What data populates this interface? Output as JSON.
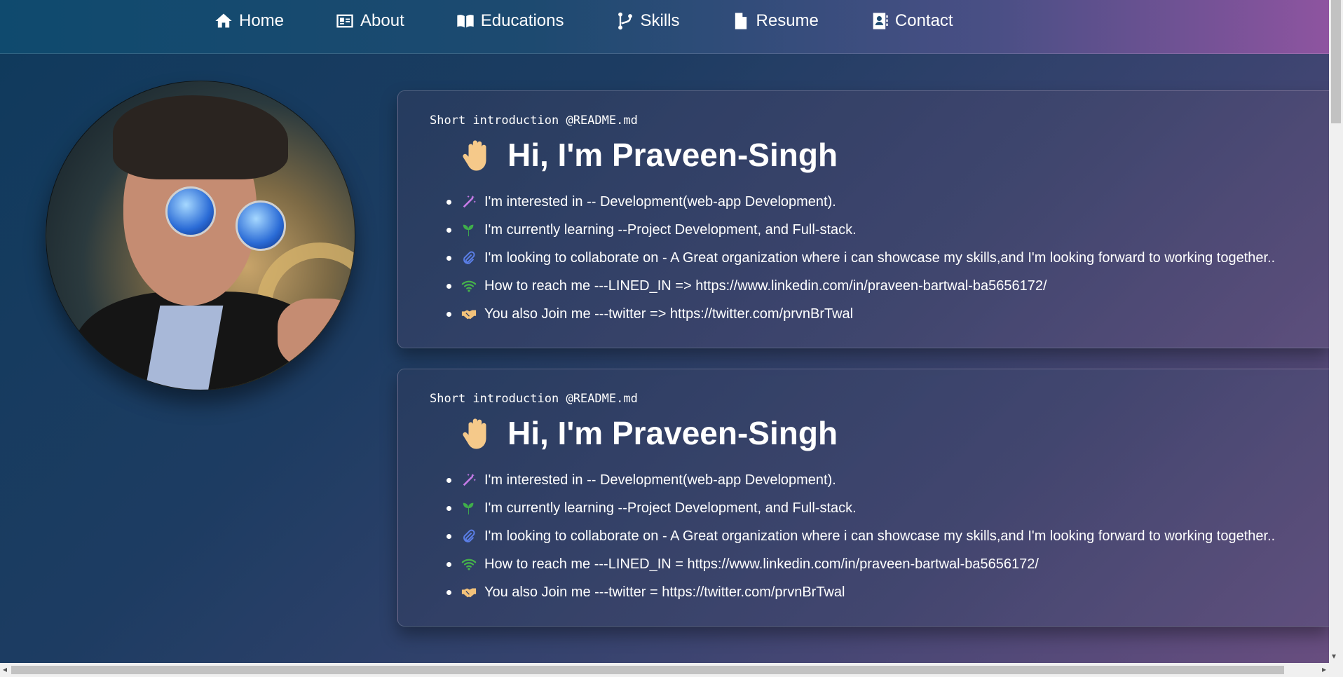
{
  "nav": {
    "items": [
      {
        "label": "Home",
        "icon": "home-icon"
      },
      {
        "label": "About",
        "icon": "id-card-icon"
      },
      {
        "label": "Educations",
        "icon": "book-icon"
      },
      {
        "label": "Skills",
        "icon": "code-branch-icon"
      },
      {
        "label": "Resume",
        "icon": "file-icon"
      },
      {
        "label": "Contact",
        "icon": "address-book-icon"
      }
    ]
  },
  "profile": {
    "image": "profile-photo"
  },
  "cards": [
    {
      "caption": "Short introduction @README.md",
      "heading": "Hi, I'm Praveen-Singh",
      "items": [
        {
          "icon": "magic-wand-icon",
          "text": "I'm interested in -- Development(web-app Development)."
        },
        {
          "icon": "seedling-icon",
          "text": "I'm currently learning --Project Development, and Full-stack."
        },
        {
          "icon": "paperclip-icon",
          "text": "I'm looking to collaborate on - A Great organization where i can showcase my skills,and I'm looking forward to working together.."
        },
        {
          "icon": "wifi-icon",
          "text": "How to reach me ---LINED_IN => https://www.linkedin.com/in/praveen-bartwal-ba5656172/"
        },
        {
          "icon": "handshake-icon",
          "text": "You also Join me ---twitter => https://twitter.com/prvnBrTwal"
        }
      ]
    },
    {
      "caption": "Short introduction @README.md",
      "heading": "Hi, I'm Praveen-Singh",
      "items": [
        {
          "icon": "magic-wand-icon",
          "text": "I'm interested in -- Development(web-app Development)."
        },
        {
          "icon": "seedling-icon",
          "text": "I'm currently learning --Project Development, and Full-stack."
        },
        {
          "icon": "paperclip-icon",
          "text": "I'm looking to collaborate on - A Great organization where i can showcase my skills,and I'm looking forward to working together.."
        },
        {
          "icon": "wifi-icon",
          "text": "How to reach me ---LINED_IN = https://www.linkedin.com/in/praveen-bartwal-ba5656172/"
        },
        {
          "icon": "handshake-icon",
          "text": "You also Join me ---twitter = https://twitter.com/prvnBrTwal"
        }
      ]
    }
  ],
  "colors": {
    "icon_magic": "#c77be8",
    "icon_seedling": "#3fae4a",
    "icon_paperclip": "#5a7ee6",
    "icon_wifi": "#46b34a",
    "icon_handshake": "#f3c27a",
    "wave_hand": "#f5c98a"
  }
}
